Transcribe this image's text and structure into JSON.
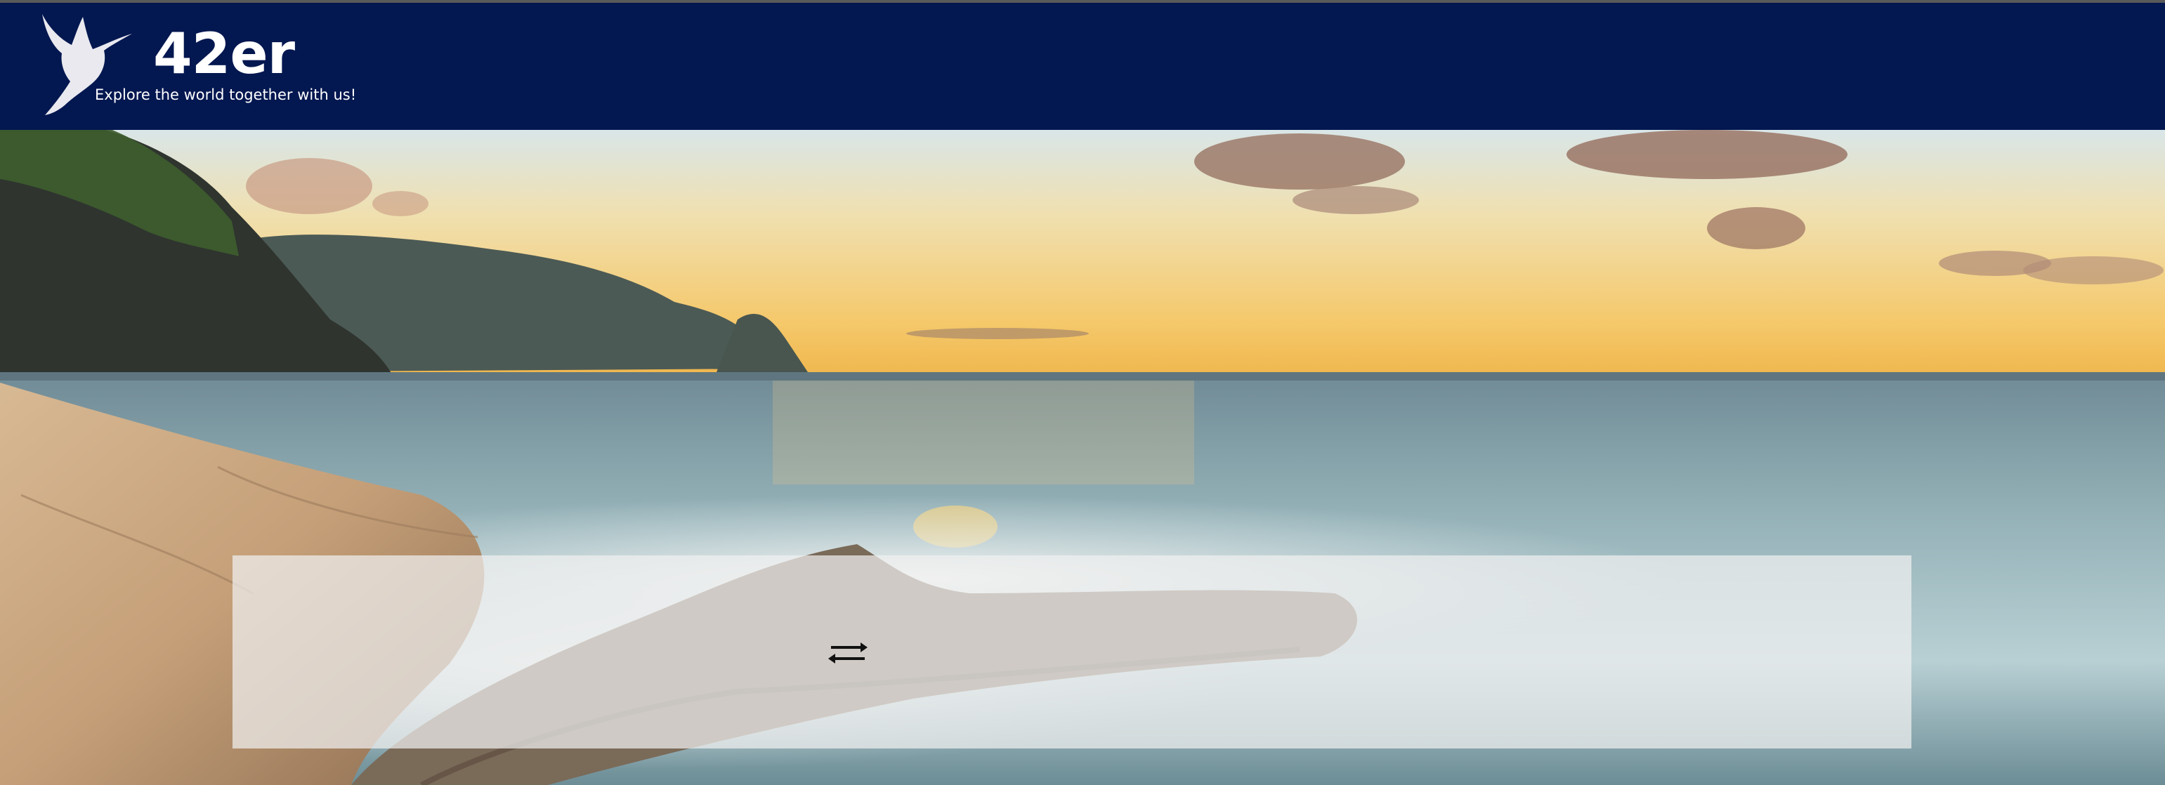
{
  "header": {
    "brand_title": "42er",
    "tagline": "Explore the world together with us!",
    "logo_icon": "hummingbird-icon"
  },
  "hero": {
    "image": "beach-sunset-image"
  },
  "search_panel": {
    "swap_icon": "swap-arrows-icon"
  },
  "colors": {
    "header_bg": "#031750",
    "panel_bg": "#f0f0f0"
  }
}
